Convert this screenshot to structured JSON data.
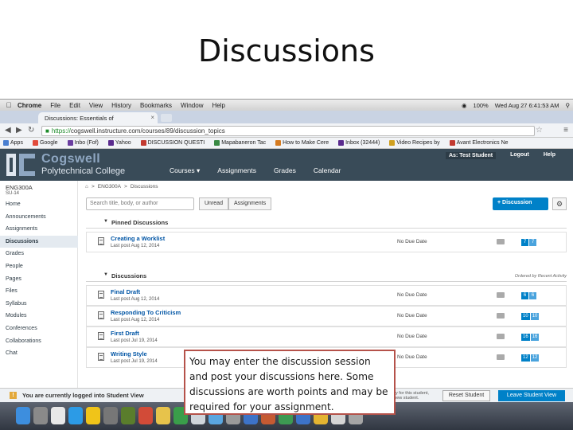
{
  "slide": {
    "title": "Discussions"
  },
  "mac_menubar": {
    "items": [
      "Chrome",
      "File",
      "Edit",
      "View",
      "History",
      "Bookmarks",
      "Window",
      "Help"
    ],
    "battery": "100%",
    "clock": "Wed Aug 27  6:41:53 AM"
  },
  "browser": {
    "tab_title": "Discussions: Essentials of",
    "url_scheme": "https://",
    "url_rest": "cogswell.instructure.com/courses/89/discussion_topics",
    "bookmarks": [
      "Apps",
      "Google",
      "Inbo (Fof)",
      "Yahoo",
      "DISCUSSION QUESTI",
      "Mapabaneron Tac",
      "How to Make Cere",
      "Inbox (32444)",
      "Video Recipes by",
      "Avant Electronics Ne"
    ]
  },
  "app": {
    "brand_name": "Cogswell",
    "brand_sub": "Polytechnical College",
    "nav": [
      "Courses",
      "Assignments",
      "Grades",
      "Calendar"
    ],
    "user_nav": [
      "As: Test Student",
      "Logout",
      "Help"
    ]
  },
  "sidebar": {
    "course_code": "ENG300A",
    "course_term": "SU-14",
    "items": [
      "Home",
      "Announcements",
      "Assignments",
      "Discussions",
      "Grades",
      "People",
      "Pages",
      "Files",
      "Syllabus",
      "Modules",
      "Conferences",
      "Collaborations",
      "Chat"
    ]
  },
  "breadcrumb": {
    "course": "ENG300A",
    "page": "Discussions"
  },
  "toolbar": {
    "search_placeholder": "Search title, body, or author",
    "unread": "Unread",
    "assignments": "Assignments",
    "add_discussion": "+ Discussion"
  },
  "pinned": {
    "heading": "Pinned Discussions",
    "rows": [
      {
        "title": "Creating a Worklist",
        "posted": "Last post Aug 12, 2014",
        "due": "No Due Date",
        "counts": [
          "7",
          "7"
        ]
      }
    ]
  },
  "discussions": {
    "heading": "Discussions",
    "ordered_by": "Ordered by Recent Activity",
    "rows": [
      {
        "title": "Final Draft",
        "posted": "Last post Aug 12, 2014",
        "due": "No Due Date",
        "counts": [
          "6",
          "6"
        ]
      },
      {
        "title": "Responding To Criticism",
        "posted": "Last post Aug 12, 2014",
        "due": "No Due Date",
        "counts": [
          "10",
          "10"
        ]
      },
      {
        "title": "First Draft",
        "posted": "Last post Jul 19, 2014",
        "due": "No Due Date",
        "counts": [
          "16",
          "16"
        ]
      },
      {
        "title": "Writing Style",
        "posted": "Last post Jul 19, 2014",
        "due": "No Due Date",
        "counts": [
          "12",
          "12"
        ]
      }
    ]
  },
  "student_view": {
    "message": "You are currently logged into Student View",
    "note": "Resetting the test student will clear all history for this student, allowing you to view the course as a brand new student.",
    "reset": "Reset Student",
    "leave": "Leave Student View"
  },
  "callout": {
    "text": "You may enter the discussion session and post your discussions here. Some discussions are worth points and may be required for your assignment."
  },
  "colors": {
    "header": "#394b58",
    "accent": "#0081c8",
    "callout_border": "#b5524a"
  }
}
